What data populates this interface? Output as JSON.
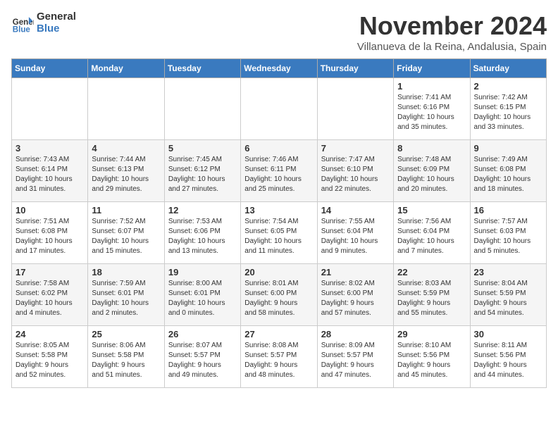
{
  "logo": {
    "line1": "General",
    "line2": "Blue"
  },
  "title": "November 2024",
  "subtitle": "Villanueva de la Reina, Andalusia, Spain",
  "headers": [
    "Sunday",
    "Monday",
    "Tuesday",
    "Wednesday",
    "Thursday",
    "Friday",
    "Saturday"
  ],
  "weeks": [
    [
      {
        "day": "",
        "detail": ""
      },
      {
        "day": "",
        "detail": ""
      },
      {
        "day": "",
        "detail": ""
      },
      {
        "day": "",
        "detail": ""
      },
      {
        "day": "",
        "detail": ""
      },
      {
        "day": "1",
        "detail": "Sunrise: 7:41 AM\nSunset: 6:16 PM\nDaylight: 10 hours\nand 35 minutes."
      },
      {
        "day": "2",
        "detail": "Sunrise: 7:42 AM\nSunset: 6:15 PM\nDaylight: 10 hours\nand 33 minutes."
      }
    ],
    [
      {
        "day": "3",
        "detail": "Sunrise: 7:43 AM\nSunset: 6:14 PM\nDaylight: 10 hours\nand 31 minutes."
      },
      {
        "day": "4",
        "detail": "Sunrise: 7:44 AM\nSunset: 6:13 PM\nDaylight: 10 hours\nand 29 minutes."
      },
      {
        "day": "5",
        "detail": "Sunrise: 7:45 AM\nSunset: 6:12 PM\nDaylight: 10 hours\nand 27 minutes."
      },
      {
        "day": "6",
        "detail": "Sunrise: 7:46 AM\nSunset: 6:11 PM\nDaylight: 10 hours\nand 25 minutes."
      },
      {
        "day": "7",
        "detail": "Sunrise: 7:47 AM\nSunset: 6:10 PM\nDaylight: 10 hours\nand 22 minutes."
      },
      {
        "day": "8",
        "detail": "Sunrise: 7:48 AM\nSunset: 6:09 PM\nDaylight: 10 hours\nand 20 minutes."
      },
      {
        "day": "9",
        "detail": "Sunrise: 7:49 AM\nSunset: 6:08 PM\nDaylight: 10 hours\nand 18 minutes."
      }
    ],
    [
      {
        "day": "10",
        "detail": "Sunrise: 7:51 AM\nSunset: 6:08 PM\nDaylight: 10 hours\nand 17 minutes."
      },
      {
        "day": "11",
        "detail": "Sunrise: 7:52 AM\nSunset: 6:07 PM\nDaylight: 10 hours\nand 15 minutes."
      },
      {
        "day": "12",
        "detail": "Sunrise: 7:53 AM\nSunset: 6:06 PM\nDaylight: 10 hours\nand 13 minutes."
      },
      {
        "day": "13",
        "detail": "Sunrise: 7:54 AM\nSunset: 6:05 PM\nDaylight: 10 hours\nand 11 minutes."
      },
      {
        "day": "14",
        "detail": "Sunrise: 7:55 AM\nSunset: 6:04 PM\nDaylight: 10 hours\nand 9 minutes."
      },
      {
        "day": "15",
        "detail": "Sunrise: 7:56 AM\nSunset: 6:04 PM\nDaylight: 10 hours\nand 7 minutes."
      },
      {
        "day": "16",
        "detail": "Sunrise: 7:57 AM\nSunset: 6:03 PM\nDaylight: 10 hours\nand 5 minutes."
      }
    ],
    [
      {
        "day": "17",
        "detail": "Sunrise: 7:58 AM\nSunset: 6:02 PM\nDaylight: 10 hours\nand 4 minutes."
      },
      {
        "day": "18",
        "detail": "Sunrise: 7:59 AM\nSunset: 6:01 PM\nDaylight: 10 hours\nand 2 minutes."
      },
      {
        "day": "19",
        "detail": "Sunrise: 8:00 AM\nSunset: 6:01 PM\nDaylight: 10 hours\nand 0 minutes."
      },
      {
        "day": "20",
        "detail": "Sunrise: 8:01 AM\nSunset: 6:00 PM\nDaylight: 9 hours\nand 58 minutes."
      },
      {
        "day": "21",
        "detail": "Sunrise: 8:02 AM\nSunset: 6:00 PM\nDaylight: 9 hours\nand 57 minutes."
      },
      {
        "day": "22",
        "detail": "Sunrise: 8:03 AM\nSunset: 5:59 PM\nDaylight: 9 hours\nand 55 minutes."
      },
      {
        "day": "23",
        "detail": "Sunrise: 8:04 AM\nSunset: 5:59 PM\nDaylight: 9 hours\nand 54 minutes."
      }
    ],
    [
      {
        "day": "24",
        "detail": "Sunrise: 8:05 AM\nSunset: 5:58 PM\nDaylight: 9 hours\nand 52 minutes."
      },
      {
        "day": "25",
        "detail": "Sunrise: 8:06 AM\nSunset: 5:58 PM\nDaylight: 9 hours\nand 51 minutes."
      },
      {
        "day": "26",
        "detail": "Sunrise: 8:07 AM\nSunset: 5:57 PM\nDaylight: 9 hours\nand 49 minutes."
      },
      {
        "day": "27",
        "detail": "Sunrise: 8:08 AM\nSunset: 5:57 PM\nDaylight: 9 hours\nand 48 minutes."
      },
      {
        "day": "28",
        "detail": "Sunrise: 8:09 AM\nSunset: 5:57 PM\nDaylight: 9 hours\nand 47 minutes."
      },
      {
        "day": "29",
        "detail": "Sunrise: 8:10 AM\nSunset: 5:56 PM\nDaylight: 9 hours\nand 45 minutes."
      },
      {
        "day": "30",
        "detail": "Sunrise: 8:11 AM\nSunset: 5:56 PM\nDaylight: 9 hours\nand 44 minutes."
      }
    ]
  ]
}
